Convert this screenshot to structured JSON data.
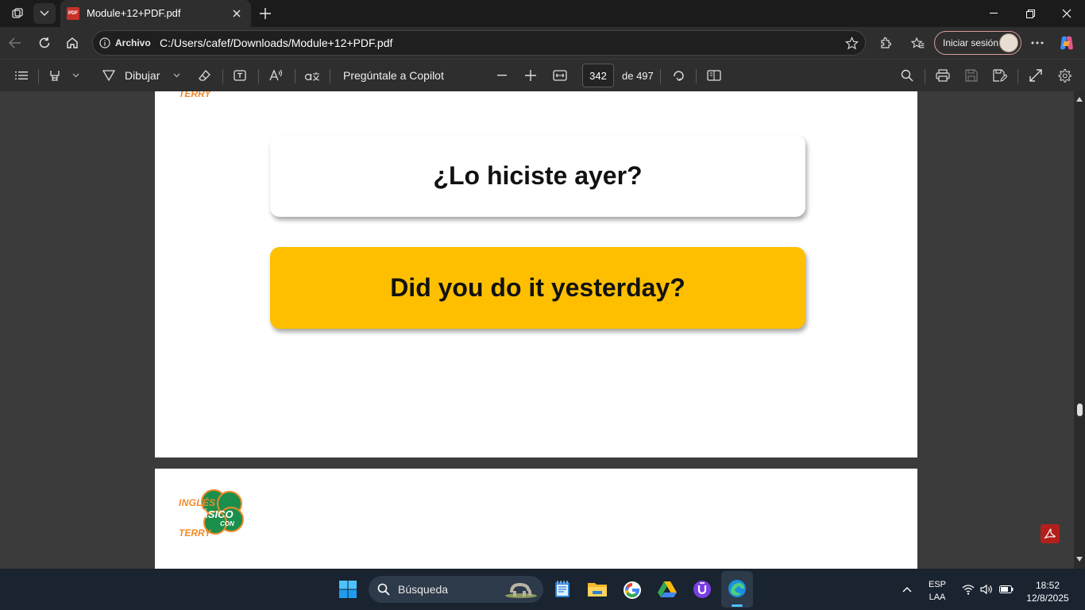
{
  "browser": {
    "tab_title": "Module+12+PDF.pdf",
    "pdf_badge": "PDF",
    "address_label": "Archivo",
    "address_url": "C:/Users/cafef/Downloads/Module+12+PDF.pdf",
    "signin_label": "Iniciar sesión"
  },
  "pdf_toolbar": {
    "draw_label": "Dibujar",
    "copilot_label": "Pregúntale a Copilot",
    "page_current": "342",
    "page_total_label": "de 497"
  },
  "document": {
    "card_spanish": "¿Lo hiciste ayer?",
    "card_english": "Did you do it yesterday?",
    "logo": {
      "line1": "INGLÉS",
      "line2": "BÁSICO",
      "line3": "CON",
      "line4": "TERRY"
    },
    "colors": {
      "card_yellow": "#FDBF00",
      "logo_green": "#1a8f4c",
      "logo_orange": "#f08a2a"
    }
  },
  "taskbar": {
    "search_placeholder": "Búsqueda",
    "lang_top": "ESP",
    "lang_bottom": "LAA",
    "time": "18:52",
    "date": "12/8/2025"
  }
}
